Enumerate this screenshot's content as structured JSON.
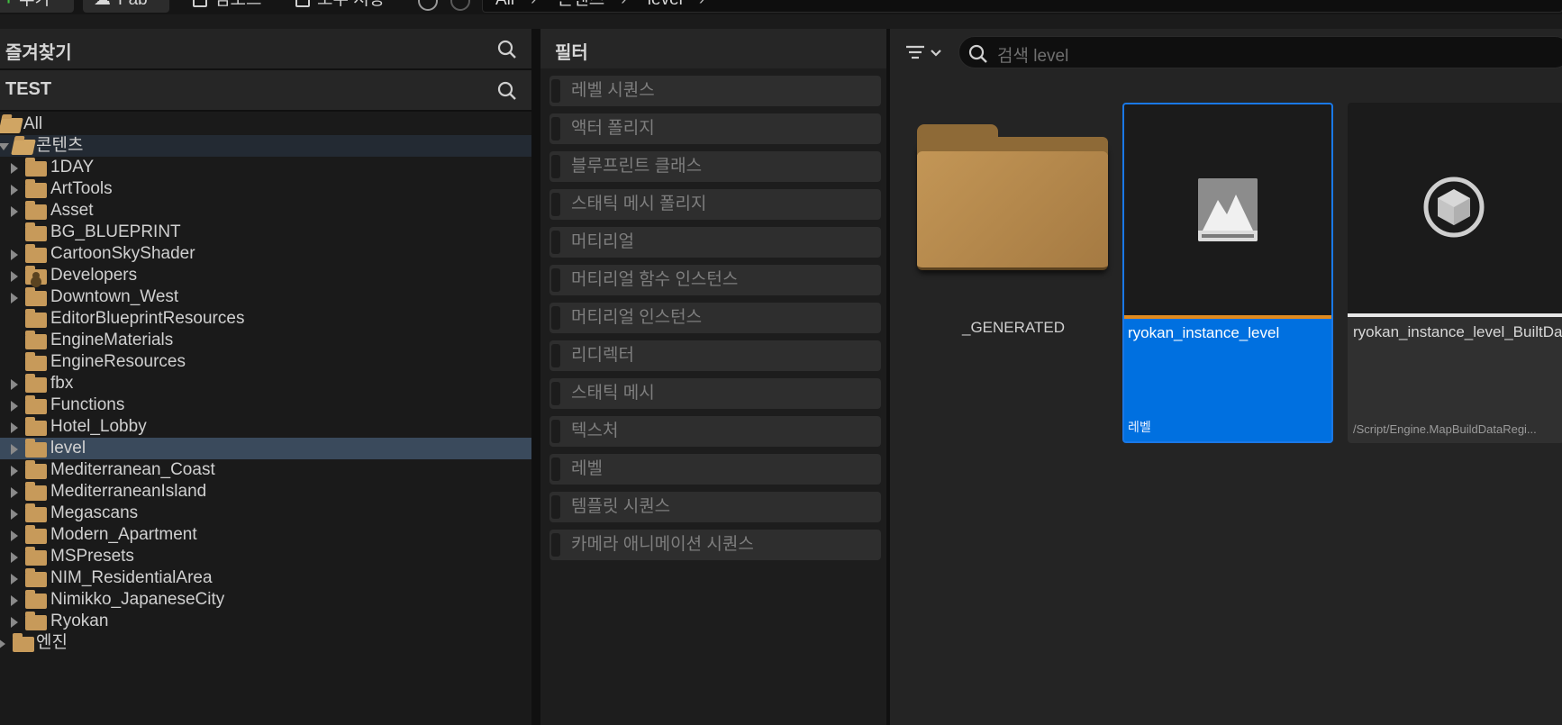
{
  "toolbar": {
    "add_label": "추가",
    "fab_label": "Fab",
    "import_label": "임포트",
    "save_all_label": "모두 저장",
    "breadcrumbs": [
      "All",
      "콘텐츠",
      "level"
    ]
  },
  "favorites": {
    "title": "즐겨찾기"
  },
  "project": {
    "title": "TEST"
  },
  "tree": [
    {
      "label": "All",
      "level": 0,
      "state": "open"
    },
    {
      "label": "콘텐츠",
      "level": 1,
      "state": "open",
      "selected": "dim"
    },
    {
      "label": "1DAY",
      "level": 2,
      "state": "closed"
    },
    {
      "label": "ArtTools",
      "level": 2,
      "state": "closed"
    },
    {
      "label": "Asset",
      "level": 2,
      "state": "closed"
    },
    {
      "label": "BG_BLUEPRINT",
      "level": 2,
      "state": "none"
    },
    {
      "label": "CartoonSkyShader",
      "level": 2,
      "state": "closed"
    },
    {
      "label": "Developers",
      "level": 2,
      "state": "closed",
      "icon": "person-folder"
    },
    {
      "label": "Downtown_West",
      "level": 2,
      "state": "closed"
    },
    {
      "label": "EditorBlueprintResources",
      "level": 2,
      "state": "none"
    },
    {
      "label": "EngineMaterials",
      "level": 2,
      "state": "none"
    },
    {
      "label": "EngineResources",
      "level": 2,
      "state": "none"
    },
    {
      "label": "fbx",
      "level": 2,
      "state": "closed"
    },
    {
      "label": "Functions",
      "level": 2,
      "state": "closed"
    },
    {
      "label": "Hotel_Lobby",
      "level": 2,
      "state": "closed"
    },
    {
      "label": "level",
      "level": 2,
      "state": "closed",
      "selected": "active"
    },
    {
      "label": "Mediterranean_Coast",
      "level": 2,
      "state": "closed"
    },
    {
      "label": "MediterraneanIsland",
      "level": 2,
      "state": "closed"
    },
    {
      "label": "Megascans",
      "level": 2,
      "state": "closed"
    },
    {
      "label": "Modern_Apartment",
      "level": 2,
      "state": "closed"
    },
    {
      "label": "MSPresets",
      "level": 2,
      "state": "closed"
    },
    {
      "label": "NIM_ResidentialArea",
      "level": 2,
      "state": "closed"
    },
    {
      "label": "Nimikko_JapaneseCity",
      "level": 2,
      "state": "closed"
    },
    {
      "label": "Ryokan",
      "level": 2,
      "state": "closed"
    },
    {
      "label": "엔진",
      "level": 1,
      "state": "closed"
    }
  ],
  "filters": {
    "title": "필터",
    "items": [
      "레벨 시퀀스",
      "액터 폴리지",
      "블루프린트 클래스",
      "스태틱 메시 폴리지",
      "머티리얼",
      "머티리얼 함수 인스턴스",
      "머티리얼 인스턴스",
      "리디렉터",
      "스태틱 메시",
      "텍스처",
      "레벨",
      "템플릿 시퀀스",
      "카메라 애니메이션 시퀀스"
    ]
  },
  "search": {
    "placeholder": "검색 level"
  },
  "assets": {
    "folder_name": "_GENERATED",
    "level_name": "ryokan_instance_level",
    "level_type": "레벨",
    "builtdata_name": "ryokan_instance_level_BuiltData",
    "builtdata_path": "/Script/Engine.MapBuildDataRegi..."
  },
  "colors": {
    "selection": "#0070e0",
    "folder": "#c79a5a",
    "accent_orange": "#e08a1e"
  }
}
